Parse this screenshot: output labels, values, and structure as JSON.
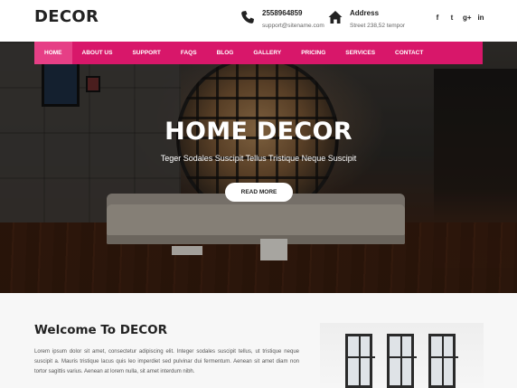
{
  "header": {
    "logo": "DECOR",
    "phone": {
      "number": "2558964859",
      "email": "support@sitename.com",
      "icon": "phone-icon"
    },
    "address": {
      "title": "Address",
      "street": "Street 238,52 tempor",
      "icon": "home-icon"
    },
    "social": [
      {
        "name": "facebook-icon",
        "glyph": "f"
      },
      {
        "name": "twitter-icon",
        "glyph": "t"
      },
      {
        "name": "google-plus-icon",
        "glyph": "g+"
      },
      {
        "name": "linkedin-icon",
        "glyph": "in"
      }
    ]
  },
  "nav": {
    "items": [
      "HOME",
      "ABOUT US",
      "SUPPORT",
      "FAQS",
      "BLOG",
      "GALLERY",
      "PRICING",
      "SERVICES",
      "CONTACT"
    ],
    "active": "HOME",
    "color": "#d8176a"
  },
  "hero": {
    "title": "HOME DECOR",
    "subtitle": "Teger Sodales Suscipit Tellus Tristique Neque Suscipit",
    "button": "READ MORE"
  },
  "welcome": {
    "title": "Welcome To DECOR",
    "text": "Lorem ipsum dolor sit amet, consectetur adipiscing elit. Integer sodales suscipit tellus, ut tristique neque suscipit a. Mauris tristique lacus quis leo imperdiet sed pulvinar dui fermentum. Aenean sit amet diam non tortor sagittis varius. Aenean at lorem nulla, sit amet interdum nibh."
  }
}
